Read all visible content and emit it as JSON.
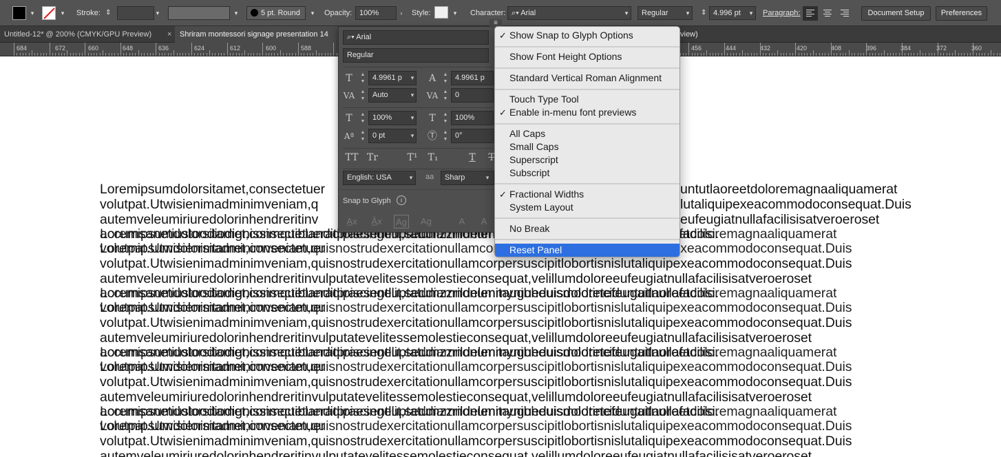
{
  "control_bar": {
    "stroke_label": "Stroke:",
    "brush_label": "5 pt. Round",
    "opacity_label": "Opacity:",
    "opacity_value": "100%",
    "style_label": "Style:",
    "character_label": "Character:",
    "font_family": "Arial",
    "font_style": "Regular",
    "font_size": "4.996 pt",
    "paragraph_label": "Paragraph:",
    "document_setup": "Document Setup",
    "preferences": "Preferences"
  },
  "tabs": [
    {
      "label": "Untitled-12* @ 200% (CMYK/GPU Preview)"
    },
    {
      "label": "Shriram montessori signage presentation 14"
    },
    {
      "label": "view)"
    }
  ],
  "tab_close": "×",
  "ruler": {
    "labels": [
      "684",
      "672",
      "660",
      "648",
      "636",
      "624",
      "612",
      "600",
      "588",
      "456",
      "444",
      "432",
      "420",
      "408",
      "396",
      "384",
      "372",
      "360"
    ]
  },
  "char_panel": {
    "font_family": "Arial",
    "font_style": "Regular",
    "size": "4.9961 p",
    "leading": "4.9961 p",
    "kerning": "Auto",
    "tracking": "0",
    "vscale": "100%",
    "hscale": "100%",
    "baseline": "0 pt",
    "rotation": "0°",
    "language": "English: USA",
    "aa_icon": "aa",
    "antialias": "Sharp",
    "snap_label": "Snap to Glyph",
    "case_buttons": [
      "TT",
      "Tr",
      "T¹",
      "T₁",
      "T",
      "T"
    ]
  },
  "menu": {
    "items": [
      {
        "label": "Show Snap to Glyph Options",
        "checked": true
      },
      {
        "label": "Show Font Height Options",
        "checked": false
      },
      {
        "label": "Standard Vertical Roman Alignment",
        "checked": false
      },
      {
        "label": "Touch Type Tool",
        "checked": false
      },
      {
        "label": "Enable in-menu font previews",
        "checked": true
      },
      {
        "label": "All Caps",
        "checked": false
      },
      {
        "label": "Small Caps",
        "checked": false
      },
      {
        "label": "Superscript",
        "checked": false
      },
      {
        "label": "Subscript",
        "checked": false
      },
      {
        "label": "Fractional Widths",
        "checked": true
      },
      {
        "label": "System Layout",
        "checked": false
      },
      {
        "label": "No Break",
        "checked": false
      },
      {
        "label": "Reset Panel",
        "checked": false,
        "highlighted": true
      }
    ],
    "check_glyph": "✓"
  },
  "canvas_text": [
    "Loremipsumdolorsitamet,consectetuer",
    "volutpat.Utwisienimadminimveniam,q",
    "autemveleumiriuredolorinhendreritinv",
    "accumsanetiustoodiodignissimquiblanditpraesentluptatumzzrildelenitaugueduisdoloretefeugaitnullafacilisi.",
    "Loremipsumdolorsitamet,consectetueradipiscingelit,seddiamnonummynibheuismodtinciduntutlaoreetdoloremagnaaliquamerat",
    "volutpat.Utwisienimadminimveniam,quisnostrudexercitationullamcorpersuscipitlobortisnislutaliquipexeacommodoconsequat.Duis",
    "autemveleumiriuredolorinhendreritinvulputatevelitessemolestieconsequat,velillumdoloreeufeugiatnullafacilisisatveroeroset",
    "untutlaoreetdoloremagnaaliquamerat",
    "lutaliquipexeacommodoconsequat.Duis",
    "eufeugiatnullafacilisisatveroeroset"
  ],
  "colors": {
    "accent": "#2d6fe0"
  }
}
